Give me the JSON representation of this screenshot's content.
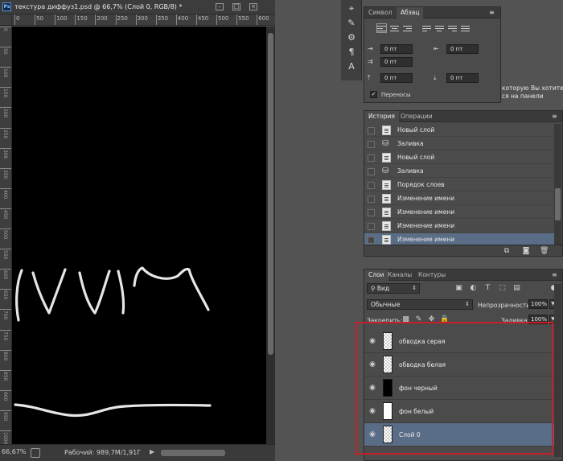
{
  "document": {
    "ps_badge": "Ps",
    "title": "текстура диффуз1.psd @ 66,7% (Слой 0, RGB/8) *",
    "ruler_top": [
      "0",
      "50",
      "100",
      "150",
      "200",
      "250",
      "300",
      "350",
      "400",
      "450",
      "500",
      "550",
      "600"
    ],
    "ruler_left": [
      "0",
      "50",
      "100",
      "150",
      "200",
      "250",
      "300",
      "350",
      "400",
      "450",
      "500",
      "550",
      "600",
      "650",
      "700",
      "750",
      "800",
      "850",
      "900",
      "950",
      "1000"
    ],
    "status": {
      "zoom": "66,67%",
      "info": "Рабочий: 989,7M/1,91Г",
      "arrow_right": "▶"
    }
  },
  "tools": [
    "text-tool-icon",
    "brush-settings-icon",
    "adjust-icon",
    "paragraph-icon",
    "character-style-icon"
  ],
  "paragraph_panel": {
    "tabs": [
      "Символ",
      "Абзац"
    ],
    "active_tab": "Абзац",
    "fields": {
      "indent_left": "0 пт",
      "indent_right": "0 пт",
      "first_line": "0 пт",
      "space_before": "0 пт",
      "space_after": "0 пт"
    },
    "hyphenate_label": "Переносы",
    "hyphenate_checked": "✓"
  },
  "tip": {
    "line1": "которую Вы хотите",
    "line2": "ся на панели"
  },
  "history_panel": {
    "tabs": [
      "История",
      "Операции"
    ],
    "active_tab": "История",
    "items": [
      {
        "label": "Новый слой",
        "icon": "document-icon"
      },
      {
        "label": "Заливка",
        "icon": "paint-bucket-icon"
      },
      {
        "label": "Новый слой",
        "icon": "document-icon"
      },
      {
        "label": "Заливка",
        "icon": "paint-bucket-icon"
      },
      {
        "label": "Порядок слоев",
        "icon": "document-icon"
      },
      {
        "label": "Изменение имени",
        "icon": "document-icon"
      },
      {
        "label": "Изменение имени",
        "icon": "document-icon"
      },
      {
        "label": "Изменение имени",
        "icon": "document-icon"
      },
      {
        "label": "Изменение имени",
        "icon": "document-icon"
      }
    ],
    "selected_index": 8
  },
  "layers_panel": {
    "tabs": [
      "Слои",
      "Каналы",
      "Контуры"
    ],
    "active_tab": "Слои",
    "filter_label": "Вид",
    "blend_mode": "Обычные",
    "opacity_label": "Непрозрачность:",
    "opacity_value": "100%",
    "lock_label": "Закрепить:",
    "fill_label": "Заливка:",
    "fill_value": "100%",
    "layers": [
      {
        "name": "обводка серая",
        "thumb": "checker"
      },
      {
        "name": "обводка белая",
        "thumb": "checker"
      },
      {
        "name": "фон черный",
        "thumb": "black"
      },
      {
        "name": "фон белый",
        "thumb": "white"
      },
      {
        "name": "Слой 0",
        "thumb": "checker"
      }
    ],
    "selected_index": 4
  },
  "colors": {
    "highlight": "#c8202a",
    "selection": "#5a6d86",
    "canvas": "#000000",
    "stroke": "#e6e6e6"
  }
}
